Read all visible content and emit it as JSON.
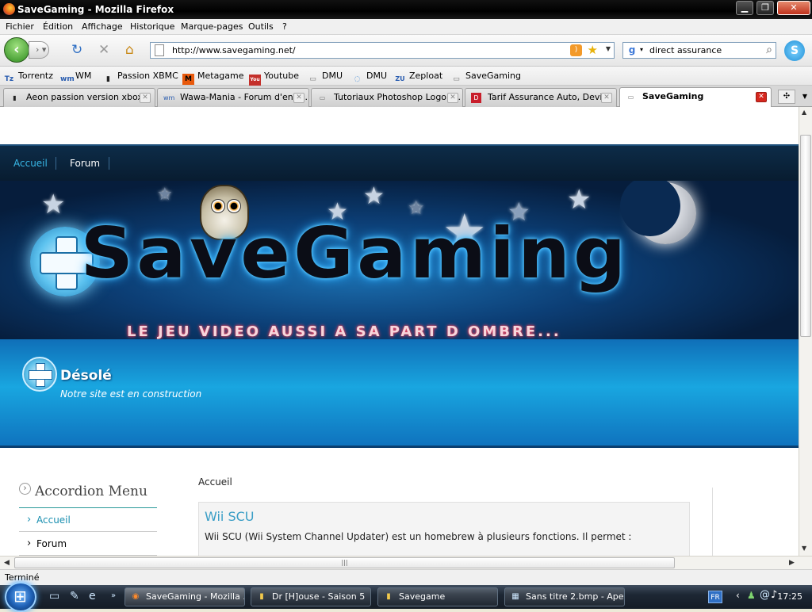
{
  "window": {
    "title": "SaveGaming - Mozilla Firefox",
    "minimize": "▁",
    "maximize": "❐",
    "close": "✕"
  },
  "menu": [
    "Fichier",
    "Édition",
    "Affichage",
    "Historique",
    "Marque-pages",
    "Outils",
    "?"
  ],
  "nav": {
    "url": "http://www.savegaming.net/",
    "search_value": "direct assurance",
    "search_engine": "g"
  },
  "bookmarks": [
    {
      "label": "Torrentz",
      "icon": "Tz"
    },
    {
      "label": "WM",
      "icon": "wm"
    },
    {
      "label": "Passion XBMC",
      "icon": "▮"
    },
    {
      "label": "Metagame",
      "icon": "M"
    },
    {
      "label": "Youtube",
      "icon": "You"
    },
    {
      "label": "DMU",
      "icon": "▭"
    },
    {
      "label": "DMU",
      "icon": "◌"
    },
    {
      "label": "Zeploat",
      "icon": "ZU"
    },
    {
      "label": "SaveGaming",
      "icon": "▭"
    }
  ],
  "tabs": [
    {
      "label": "Aeon passion version xbox",
      "icon": "▮"
    },
    {
      "label": "Wawa-Mania - Forum d'entr...",
      "icon": "wm"
    },
    {
      "label": "Tutoriaux Photoshop Logo -...",
      "icon": "▭"
    },
    {
      "label": "Tarif Assurance Auto, Devi...",
      "icon": "D"
    },
    {
      "label": "SaveGaming",
      "icon": "▭"
    }
  ],
  "site": {
    "nav": [
      "Accueil",
      "Forum"
    ],
    "logo": "SaveGaming",
    "tagline": "LE JEU VIDEO AUSSI A SA PART D  OMBRE...",
    "heading": "Désolé",
    "subheading": "Notre site est en construction",
    "sidebar_title": "Accordion Menu",
    "sidebar_items": [
      "Accueil",
      "Forum"
    ],
    "breadcrumb": "Accueil",
    "article_title": "Wii SCU",
    "article_body": "Wii SCU (Wii System Channel Updater) est un homebrew à plusieurs fonctions. Il permet :"
  },
  "status": "Terminé",
  "taskbar": {
    "items": [
      {
        "label": "SaveGaming - Mozilla ...",
        "icon": "◉"
      },
      {
        "label": "Dr [H]ouse - Saison 5",
        "icon": "▮"
      },
      {
        "label": "Savegame",
        "icon": "▮"
      },
      {
        "label": "Sans titre 2.bmp - Ape...",
        "icon": "▦"
      }
    ],
    "lang": "FR",
    "time": "17:25"
  },
  "colors": {
    "accent": "#1a8fb0",
    "link": "#3a9ec6",
    "banner": "#0c3e75"
  }
}
